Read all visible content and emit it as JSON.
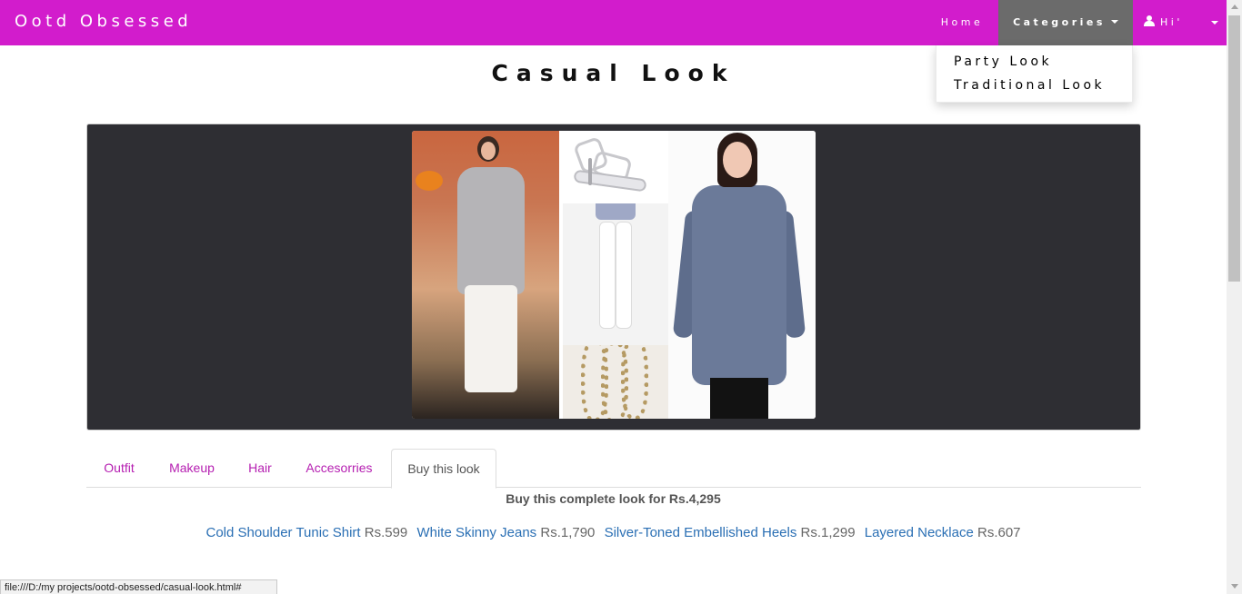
{
  "navbar": {
    "brand": "Ootd Obsessed",
    "home_label": "Home",
    "categories_label": "Categories",
    "user_label": "Hi'",
    "colors": {
      "nav_bg": "#d21ccc",
      "active_bg": "#6b6b6b"
    }
  },
  "dropdown": {
    "items": [
      "Party Look",
      "Traditional Look"
    ]
  },
  "page": {
    "title": "Casual Look"
  },
  "tabs": {
    "items": [
      "Outfit",
      "Makeup",
      "Hair",
      "Accesorries",
      "Buy this look"
    ],
    "active": "Buy this look",
    "accent_color": "#b51eb1"
  },
  "buy": {
    "headline": "Buy this complete look for Rs.4,295",
    "products": [
      {
        "name": "Cold Shoulder Tunic Shirt",
        "price": "Rs.599"
      },
      {
        "name": "White Skinny Jeans",
        "price": "Rs.1,790"
      },
      {
        "name": "Silver-Toned Embellished Heels",
        "price": "Rs.1,299"
      },
      {
        "name": "Layered Necklace",
        "price": "Rs.607"
      }
    ]
  },
  "statusbar": {
    "url": "file:///D:/my projects/ootd-obsessed/casual-look.html#"
  },
  "icons": {
    "user": "user-icon",
    "caret": "caret-down-icon"
  }
}
